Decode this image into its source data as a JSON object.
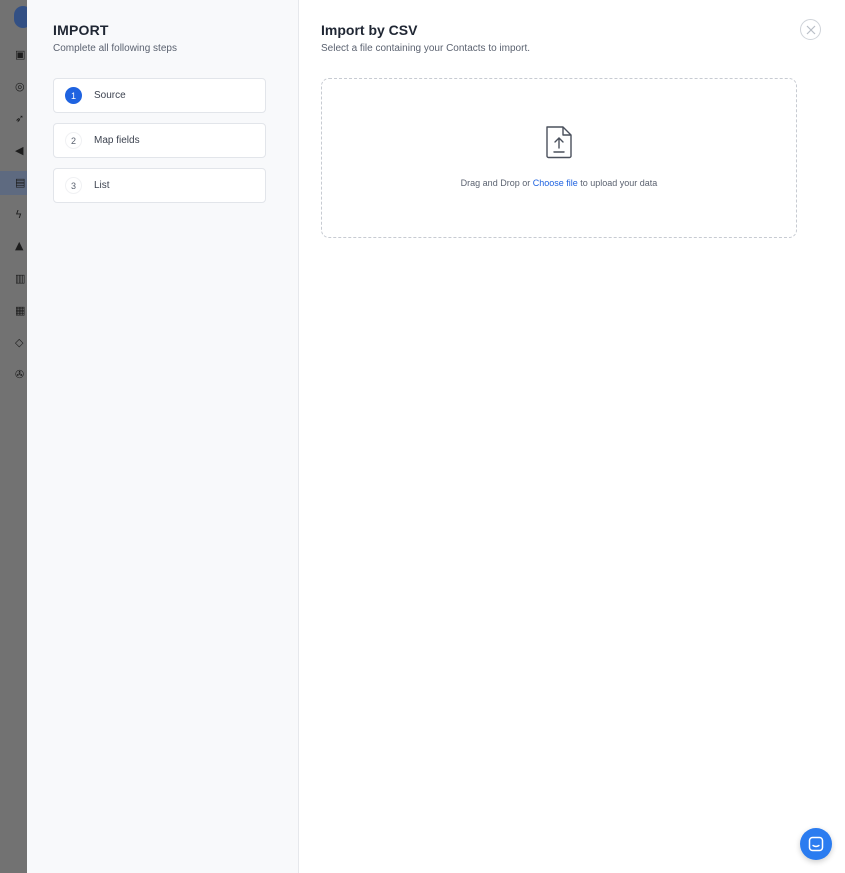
{
  "import_panel": {
    "title": "IMPORT",
    "subtitle": "Complete all following steps",
    "steps": [
      {
        "number": "1",
        "label": "Source",
        "active": true
      },
      {
        "number": "2",
        "label": "Map fields",
        "active": false
      },
      {
        "number": "3",
        "label": "List",
        "active": false
      }
    ]
  },
  "main": {
    "title": "Import by CSV",
    "subtitle": "Select a file containing your Contacts to import.",
    "dropzone": {
      "prefix": "Drag and Drop or ",
      "link": "Choose file",
      "suffix": " to upload your data",
      "icon": "file-upload-icon"
    },
    "close_icon": "close-icon"
  },
  "chat": {
    "icon": "chat-bubble-icon"
  },
  "colors": {
    "accent": "#1f63e0",
    "chat": "#2b7cf0",
    "backdrop": "#6d6d6d"
  },
  "background_rail_icons": [
    "layout-icon",
    "target-icon",
    "rocket-icon",
    "megaphone-icon",
    "contacts-icon",
    "lightning-icon",
    "bell-icon",
    "grid-icon",
    "apps-icon",
    "tag-icon",
    "plug-icon"
  ]
}
